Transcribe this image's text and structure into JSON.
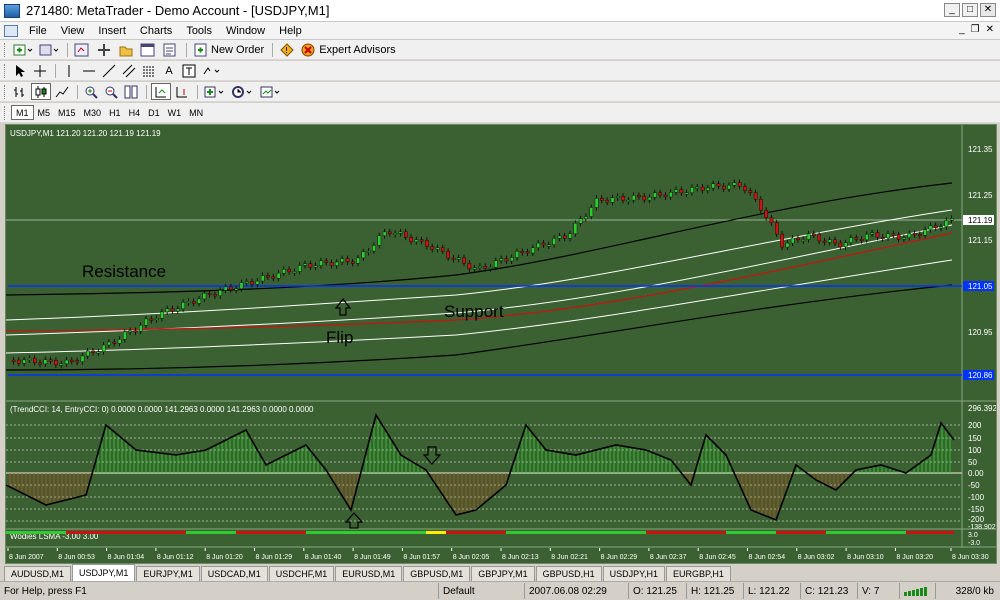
{
  "window": {
    "title": "271480: MetaTrader - Demo Account - [USDJPY,M1]"
  },
  "menu": [
    "File",
    "View",
    "Insert",
    "Charts",
    "Tools",
    "Window",
    "Help"
  ],
  "toolbar": {
    "new_order": "New Order",
    "expert_advisors": "Expert Advisors",
    "text_tool": "A"
  },
  "timeframes": {
    "items": [
      "M1",
      "M5",
      "M15",
      "M30",
      "H1",
      "H4",
      "D1",
      "W1",
      "MN"
    ],
    "active": "M1"
  },
  "chart": {
    "header": "USDJPY,M1  121.20 121.20 121.19 121.19",
    "price_labels": [
      "121.35",
      "121.25",
      "121.19",
      "121.15",
      "121.05",
      "120.95",
      "120.86"
    ],
    "annotations": {
      "resistance": "Resistance",
      "support": "Support",
      "flip": "Flip"
    },
    "colors": {
      "background": "#3b6132",
      "bull": "#2ecc2e",
      "bear": "#cc1111",
      "line_blue": "#0033ff"
    }
  },
  "cci": {
    "header": "(TrendCCI: 14, EntryCCI: 0)  0.0000 0.0000 141.2963 0.0000 141.2963 0.0000 0.0000",
    "levels": [
      "296.3924",
      "200",
      "150",
      "100",
      "50",
      "0.00",
      "-50",
      "-100",
      "-150",
      "-200",
      "-138.902"
    ]
  },
  "lsma": {
    "header": "Wodies LSMA -3.00 3.00",
    "values": [
      "3.0",
      "-3.0"
    ]
  },
  "time_axis": [
    "8 Jun 2007",
    "8 Jun 00:53",
    "8 Jun 01:04",
    "8 Jun 01:12",
    "8 Jun 01:20",
    "8 Jun 01:29",
    "8 Jun 01:40",
    "8 Jun 01:49",
    "8 Jun 01:57",
    "8 Jun 02:05",
    "8 Jun 02:13",
    "8 Jun 02:21",
    "8 Jun 02:29",
    "8 Jun 02:37",
    "8 Jun 02:45",
    "8 Jun 02:54",
    "8 Jun 03:02",
    "8 Jun 03:10",
    "8 Jun 03:20",
    "8 Jun 03:30"
  ],
  "tabs": {
    "items": [
      "AUDUSD,M1",
      "USDJPY,M1",
      "EURJPY,M1",
      "USDCAD,M1",
      "USDCHF,M1",
      "EURUSD,M1",
      "GBPUSD,M1",
      "GBPJPY,M1",
      "GBPUSD,H1",
      "USDJPY,H1",
      "EURGBP,H1"
    ],
    "active": "USDJPY,M1"
  },
  "status": {
    "help": "For Help, press F1",
    "profile": "Default",
    "datetime": "2007.06.08 02:29",
    "open": "O: 121.25",
    "high": "H: 121.25",
    "low": "L: 121.22",
    "close": "C: 121.23",
    "volume": "V: 7",
    "traffic": "328/0 kb"
  }
}
